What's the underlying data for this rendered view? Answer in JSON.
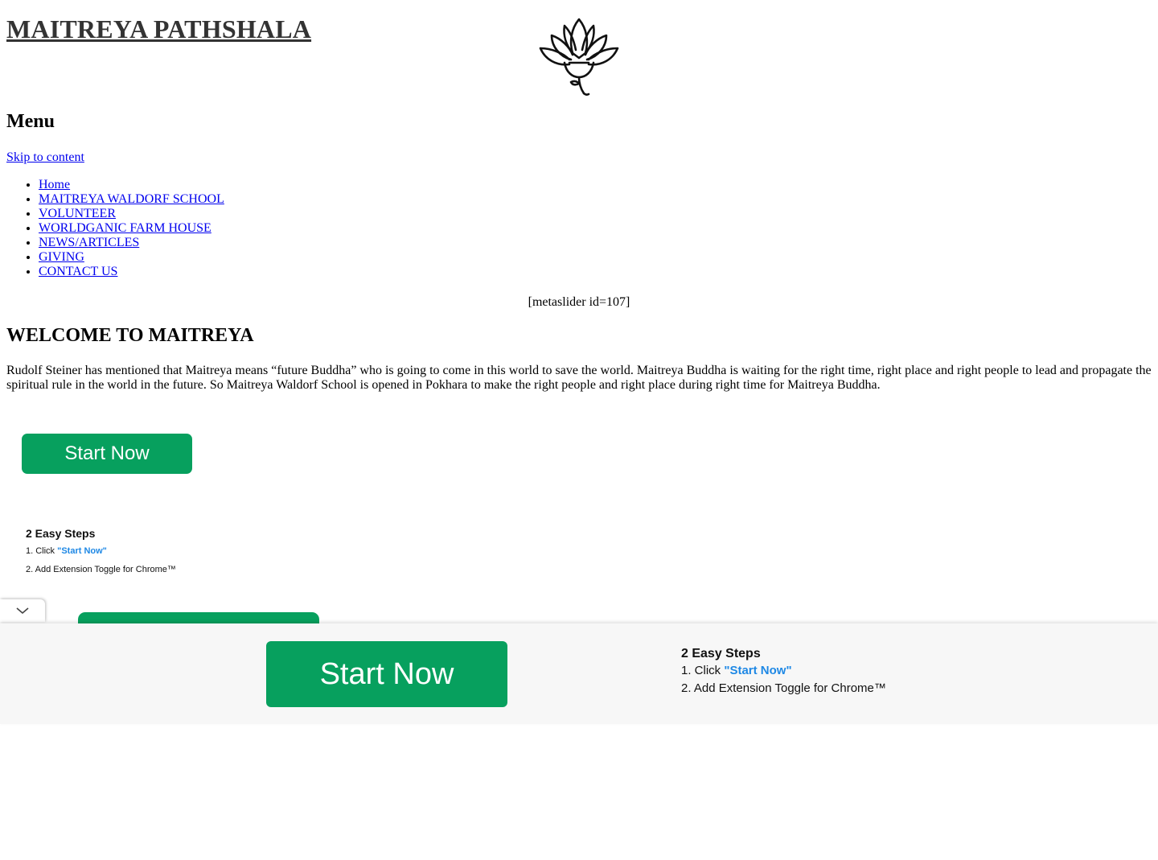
{
  "site": {
    "title": "MAITREYA PATHSHALA"
  },
  "menu": {
    "title": "Menu",
    "skip_link": "Skip to content",
    "items": [
      "Home",
      "MAITREYA WALDORF SCHOOL",
      "VOLUNTEER",
      "WORLDGANIC FARM HOUSE",
      "NEWS/ARTICLES",
      "GIVING",
      "CONTACT US"
    ]
  },
  "slider": {
    "shortcode": "[metaslider id=107]"
  },
  "content": {
    "heading": "WELCOME TO MAITREYA",
    "paragraph": "Rudolf Steiner has mentioned that Maitreya means “future Buddha” who is going to come in this world to save the world. Maitreya Buddha is waiting for the right time, right place and right people to lead and propagate the spiritual rule in the world in the future. So Maitreya Waldorf School is opened in Pokhara to make the right people and right place during right time for Maitreya Buddha."
  },
  "ad": {
    "button_label": "Start Now",
    "steps_title": "2 Easy Steps",
    "step1_prefix": "1. Click ",
    "step1_link": "\"Start Now\"",
    "step2": "2. Add Extension Toggle for Chrome™",
    "button_color": "#07a05e",
    "link_color": "#1e88e5"
  },
  "icons": {
    "logo": "lotus-icon",
    "collapse": "chevron-down-icon"
  }
}
